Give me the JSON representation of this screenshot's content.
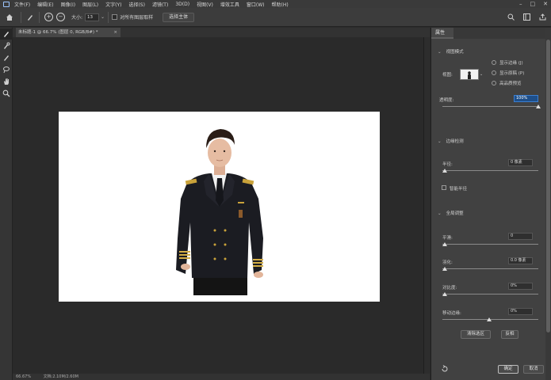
{
  "menubar": {
    "items": [
      "文件(F)",
      "编辑(E)",
      "图像(I)",
      "图层(L)",
      "文字(Y)",
      "选择(S)",
      "滤镜(T)",
      "3D(D)",
      "视图(V)",
      "增效工具",
      "窗口(W)",
      "帮助(H)"
    ]
  },
  "options": {
    "size_label": "大小:",
    "size_value": "13",
    "sample_all_label": "对所有图层取样",
    "select_subject": "选择主体"
  },
  "document": {
    "tab_title": "未标题-1 @ 66.7% (图层 0, RGB/8#) *",
    "status_zoom": "66.67%",
    "status_info": "文档:2.10M/2.60M"
  },
  "panel": {
    "tab": "属性",
    "view_mode": "视图模式",
    "view_label": "视图:",
    "show_edge": "显示边缘 (J)",
    "show_original": "显示原稿 (P)",
    "hq_preview": "高品质预览",
    "opacity_label": "透明度:",
    "opacity_value": "100%",
    "edge_detection": "边缘检测",
    "radius_label": "半径:",
    "radius_value": "0 像素",
    "smart_radius": "智能半径",
    "global_refine": "全局调整",
    "smooth_label": "平滑:",
    "smooth_value": "0",
    "feather_label": "羽化:",
    "feather_value": "0.0 像素",
    "contrast_label": "对比度:",
    "contrast_value": "0%",
    "shift_edge_label": "移动边缘:",
    "shift_edge_value": "0%",
    "clear_selection": "清除选区",
    "invert": "反相",
    "ok": "确定",
    "cancel": "取消"
  }
}
